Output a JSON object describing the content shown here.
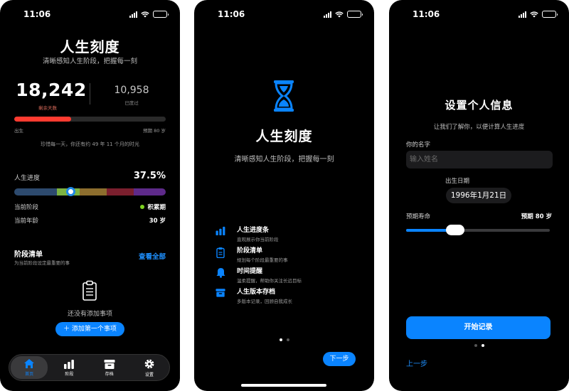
{
  "status": {
    "time": "11:06"
  },
  "home": {
    "title": "人生刻度",
    "subtitle": "清晰感知人生阶段，把握每一刻",
    "remaining_days": "18,242",
    "remaining_label": "剩余天数",
    "lived_days": "10,958",
    "lived_label": "已度过",
    "life_bar_fraction": 0.375,
    "bar_start_label": "出生",
    "bar_end_label": "预期 80 岁",
    "cherish_text": "珍惜每一天，你还有约 49 年 11 个月的时光",
    "progress_label": "人生进度",
    "progress_value": "37.5%",
    "stage_label": "当前阶段",
    "stage_value": "积累期",
    "age_label": "当前年龄",
    "age_value": "30 岁",
    "list_title": "阶段清单",
    "list_subtitle": "为当前阶段设定最重要的事",
    "view_all": "查看全部",
    "empty_text": "还没有添加事项",
    "add_button": "＋ 添加第一个事项",
    "tabs": [
      {
        "label": "首页",
        "icon": "home-icon"
      },
      {
        "label": "阶段",
        "icon": "bar-chart-icon"
      },
      {
        "label": "存档",
        "icon": "archive-icon"
      },
      {
        "label": "设置",
        "icon": "gear-icon"
      }
    ],
    "colors": {
      "accent": "#0a84ff",
      "progress_red": "#ff3b30",
      "stage_dot": "#7ed321"
    }
  },
  "onboard": {
    "title": "人生刻度",
    "subtitle": "清晰感知人生阶段，把握每一刻",
    "features": [
      {
        "title": "人生进度条",
        "desc": "直观展示你当前阶段",
        "icon": "bar-chart-icon"
      },
      {
        "title": "阶段清单",
        "desc": "规划每个阶段最重要的事",
        "icon": "clipboard-icon"
      },
      {
        "title": "时间提醒",
        "desc": "温柔提醒，帮助你关注长远目标",
        "icon": "bell-icon"
      },
      {
        "title": "人生版本存档",
        "desc": "多版本记录，回顾自我成长",
        "icon": "archive-icon"
      }
    ],
    "next_button": "下一步"
  },
  "setup": {
    "title": "设置个人信息",
    "subtitle": "让我们了解你，以便计算人生进度",
    "name_label": "你的名字",
    "name_placeholder": "输入姓名",
    "birth_label": "出生日期",
    "birth_value": "1996年1月21日",
    "life_label": "预期寿命",
    "life_value": "预期 80 岁",
    "slider_fraction": 0.34,
    "start_button": "开始记录",
    "back_link": "上一步"
  }
}
